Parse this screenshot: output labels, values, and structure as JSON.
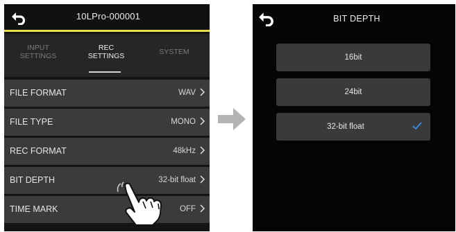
{
  "left_screen": {
    "title": "10LPro-000001",
    "tabs": [
      {
        "line1": "INPUT",
        "line2": "SETTINGS",
        "active": false
      },
      {
        "line1": "REC",
        "line2": "SETTINGS",
        "active": true
      },
      {
        "line1": "SYSTEM",
        "line2": "",
        "active": false
      }
    ],
    "rows": [
      {
        "label": "FILE FORMAT",
        "value": "WAV"
      },
      {
        "label": "FILE TYPE",
        "value": "MONO"
      },
      {
        "label": "REC FORMAT",
        "value": "48kHz"
      },
      {
        "label": "BIT DEPTH",
        "value": "32-bit float"
      },
      {
        "label": "TIME MARK",
        "value": "OFF"
      }
    ],
    "accent_color": "#e8df4a"
  },
  "right_screen": {
    "title": "BIT DEPTH",
    "options": [
      {
        "label": "16bit",
        "selected": false
      },
      {
        "label": "24bit",
        "selected": false
      },
      {
        "label": "32-bit float",
        "selected": true
      }
    ],
    "check_color": "#3a8ee6"
  },
  "icons": {
    "back": "back-arrow-icon",
    "chevron": "chevron-right-icon",
    "check": "checkmark-icon",
    "hand": "pointing-hand-icon",
    "transition": "right-arrow-icon"
  }
}
